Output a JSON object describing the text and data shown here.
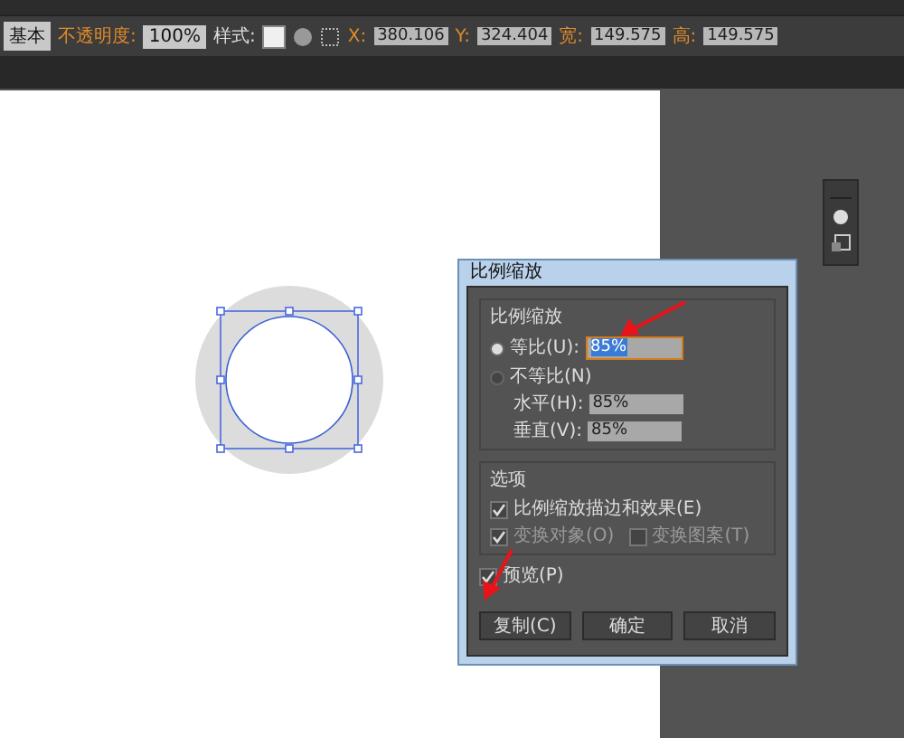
{
  "toolbar": {
    "stroke_style": "基本",
    "opacity_label": "不透明度:",
    "opacity": "100%",
    "style_label": "样式:",
    "fields": [
      {
        "label": "X:",
        "value": "380.106"
      },
      {
        "label": "Y:",
        "value": "324.404"
      },
      {
        "label": "宽:",
        "value": "149.575"
      },
      {
        "label": "高:",
        "value": "149.575"
      }
    ]
  },
  "dialog": {
    "title": "比例缩放",
    "scale_group": {
      "title": "比例缩放",
      "options": [
        {
          "label": "等比(U):",
          "selected": true,
          "value": "85%"
        },
        {
          "label": "不等比(N)",
          "selected": false
        }
      ],
      "fields": [
        {
          "label": "水平(H):",
          "value": "85%"
        },
        {
          "label": "垂直(V):",
          "value": "85%"
        }
      ]
    },
    "options_group": {
      "title": "选项",
      "checkboxes": [
        {
          "label": "比例缩放描边和效果(E)",
          "checked": true,
          "disabled": false
        },
        {
          "label": "变换对象(O)",
          "checked": true,
          "disabled": true
        },
        {
          "label": "变换图案(T)",
          "checked": false,
          "disabled": true
        }
      ]
    },
    "preview": {
      "label": "预览(P)",
      "checked": true
    },
    "buttons": [
      "复制(C)",
      "确定",
      "取消"
    ]
  }
}
